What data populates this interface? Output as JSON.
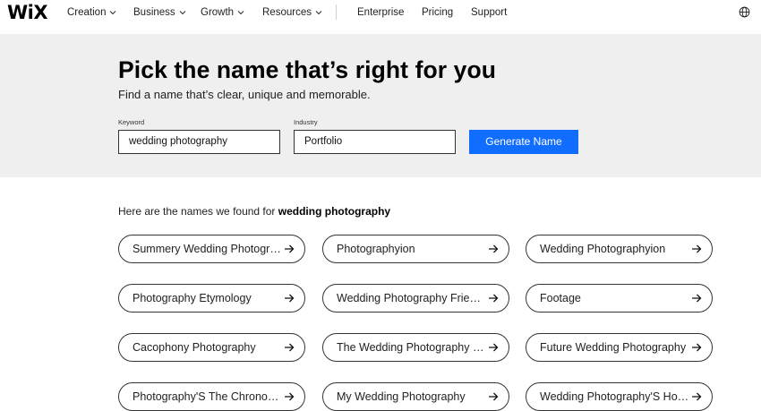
{
  "nav": {
    "logo": "WiX",
    "menus": [
      {
        "label": "Creation"
      },
      {
        "label": "Business"
      },
      {
        "label": "Growth"
      },
      {
        "label": "Resources"
      }
    ],
    "links": [
      {
        "label": "Enterprise"
      },
      {
        "label": "Pricing"
      },
      {
        "label": "Support"
      }
    ],
    "globe_icon": "globe-icon"
  },
  "hero": {
    "title": "Pick the name that’s right for you",
    "subtitle": "Find a name that’s clear, unique and memorable.",
    "keyword": {
      "label": "Keyword",
      "value": "wedding photography"
    },
    "industry": {
      "label": "Industry",
      "value": "Portfolio"
    },
    "generate_label": "Generate Name"
  },
  "results": {
    "intro": "Here are the names we found for ",
    "query": "wedding photography",
    "names": [
      "Summery Wedding Photography",
      "Photographyion",
      "Wedding Photographyion",
      "Photography Etymology",
      "Wedding Photography Friends",
      "Footage",
      "Cacophony Photography",
      "The Wedding Photography Pros",
      "Future Wedding Photography",
      "Photography'S The Chronophotography",
      "My Wedding Photography",
      "Wedding Photography'S Home"
    ]
  },
  "colors": {
    "accent": "#116dff",
    "hero_bg": "#efefef"
  }
}
